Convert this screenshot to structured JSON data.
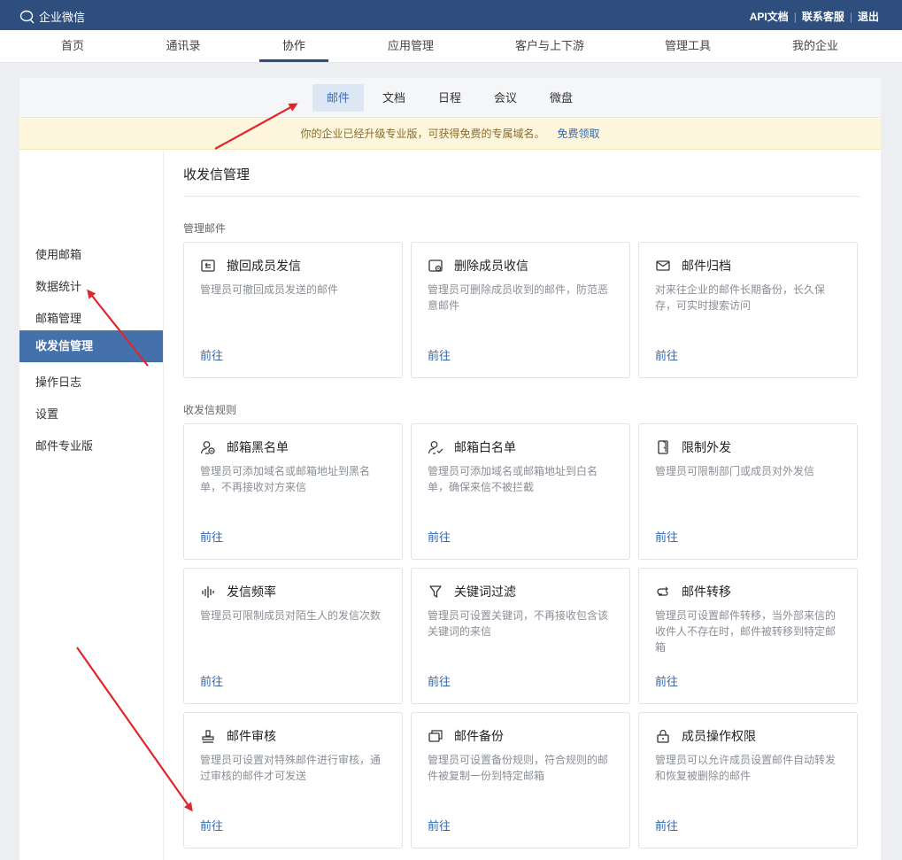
{
  "app": {
    "name": "企业微信"
  },
  "toplinks": [
    "API文档",
    "联系客服",
    "退出"
  ],
  "mainnav": [
    "首页",
    "通讯录",
    "协作",
    "应用管理",
    "客户与上下游",
    "管理工具",
    "我的企业"
  ],
  "subnav": [
    "邮件",
    "文档",
    "日程",
    "会议",
    "微盘"
  ],
  "notice": {
    "text": "你的企业已经升级专业版，可获得免费的专属域名。",
    "link": "免费领取"
  },
  "sidebar": [
    "使用邮箱",
    "数据统计",
    "邮箱管理",
    "收发信管理",
    "操作日志",
    "设置",
    "邮件专业版"
  ],
  "content": {
    "title": "收发信管理",
    "sections": [
      {
        "label": "管理邮件",
        "cards": [
          {
            "icon": "recall-icon",
            "title": "撤回成员发信",
            "desc": "管理员可撤回成员发送的邮件",
            "link": "前往"
          },
          {
            "icon": "delete-mail-icon",
            "title": "删除成员收信",
            "desc": "管理员可删除成员收到的邮件，防范恶意邮件",
            "link": "前往"
          },
          {
            "icon": "archive-mail-icon",
            "title": "邮件归档",
            "desc": "对来往企业的邮件长期备份，长久保存，可实时搜索访问",
            "link": "前往"
          }
        ]
      },
      {
        "label": "收发信规则",
        "cards": [
          {
            "icon": "blacklist-user-icon",
            "title": "邮箱黑名单",
            "desc": "管理员可添加域名或邮箱地址到黑名单，不再接收对方来信",
            "link": "前往"
          },
          {
            "icon": "whitelist-user-icon",
            "title": "邮箱白名单",
            "desc": "管理员可添加域名或邮箱地址到白名单，确保来信不被拦截",
            "link": "前往"
          },
          {
            "icon": "restrict-send-icon",
            "title": "限制外发",
            "desc": "管理员可限制部门或成员对外发信",
            "link": "前往"
          },
          {
            "icon": "frequency-icon",
            "title": "发信频率",
            "desc": "管理员可限制成员对陌生人的发信次数",
            "link": "前往"
          },
          {
            "icon": "filter-icon",
            "title": "关键词过滤",
            "desc": "管理员可设置关键词，不再接收包含该关键词的来信",
            "link": "前往"
          },
          {
            "icon": "transfer-icon",
            "title": "邮件转移",
            "desc": "管理员可设置邮件转移，当外部来信的收件人不存在时，邮件被转移到特定邮箱",
            "link": "前往"
          },
          {
            "icon": "stamp-icon",
            "title": "邮件审核",
            "desc": "管理员可设置对特殊邮件进行审核，通过审核的邮件才可发送",
            "link": "前往"
          },
          {
            "icon": "backup-icon",
            "title": "邮件备份",
            "desc": "管理员可设置备份规则，符合规则的邮件被复制一份到特定邮箱",
            "link": "前往"
          },
          {
            "icon": "lock-icon",
            "title": "成员操作权限",
            "desc": "管理员可以允许成员设置邮件自动转发和恢复被删除的邮件",
            "link": "前往"
          }
        ]
      }
    ]
  },
  "colors": {
    "topbar": "#2e4e7e",
    "active_side": "#4471ab",
    "link": "#2f67b0",
    "arrow": "#e0262b"
  }
}
